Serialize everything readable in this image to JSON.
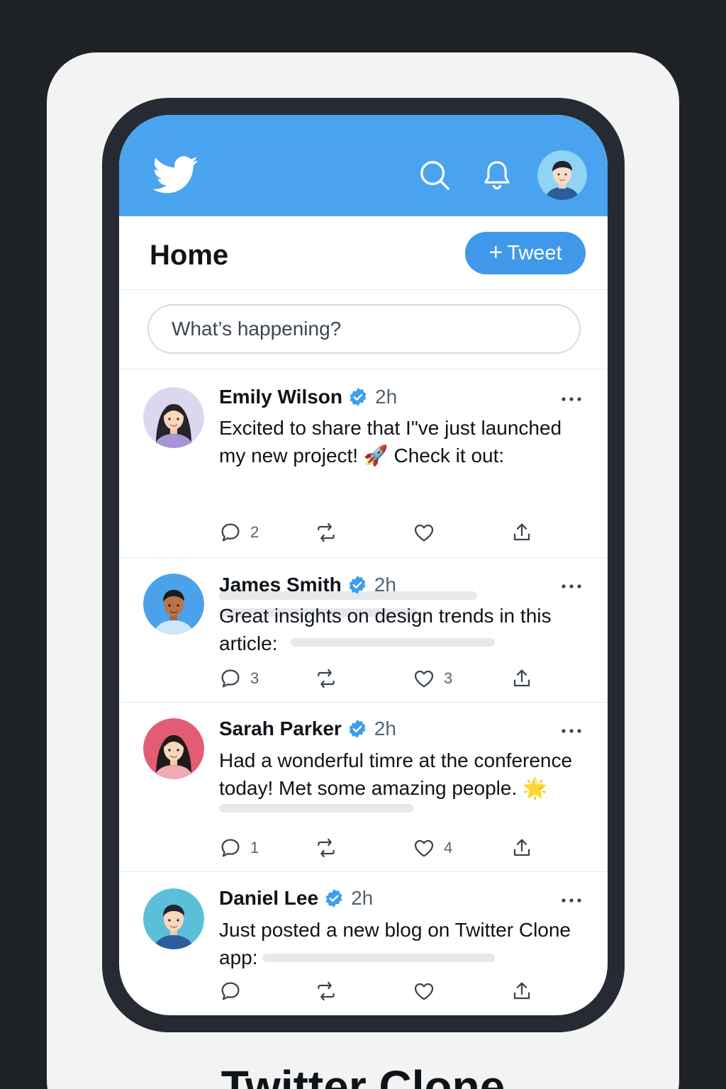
{
  "header": {
    "logo_icon": "twitter-bird-icon",
    "search_icon": "search-icon",
    "notifications_icon": "bell-icon",
    "profile_avatar": "user-avatar",
    "background_color": "#4aa3ee"
  },
  "home": {
    "title": "Home",
    "tweet_button_plus": "+",
    "tweet_button_label": "Tweet",
    "accent_color": "#3f98ea"
  },
  "composer": {
    "placeholder": "What’s happening?"
  },
  "tweets": [
    {
      "name": "Emily Wilson",
      "verified": true,
      "time": "2h",
      "text_line1": "Excited to share that I\"ve just launched",
      "text_line2_start": "my new project!",
      "emoji": "🚀",
      "text_line2_end": "Check it out:",
      "reply_count": "2",
      "retweet_count": "",
      "like_count": "",
      "share_icon": "share-icon"
    },
    {
      "name": "James Smith",
      "verified": true,
      "time": "2h",
      "text_line1": "Great insights on design trends in this",
      "text_line2_start": "article:",
      "reply_count": "3",
      "retweet_count": "",
      "like_count": "3",
      "share_icon": "share-icon"
    },
    {
      "name": "Sarah Parker",
      "verified": true,
      "time": "2h",
      "text_line1": "Had a wonderful timre at the conference",
      "text_line2_start": "today! Met some amazing people.",
      "emoji": "🌟",
      "reply_count": "1",
      "retweet_count": "",
      "like_count": "4",
      "share_icon": "share-icon"
    },
    {
      "name": "Daniel Lee",
      "verified": true,
      "time": "2h",
      "text_line1": "Just posted a new blog on Twitter Clone",
      "text_line2_start": "app:",
      "reply_count": "",
      "retweet_count": "",
      "like_count": "",
      "share_icon": "share-icon"
    }
  ],
  "caption": "Twitter Clone"
}
